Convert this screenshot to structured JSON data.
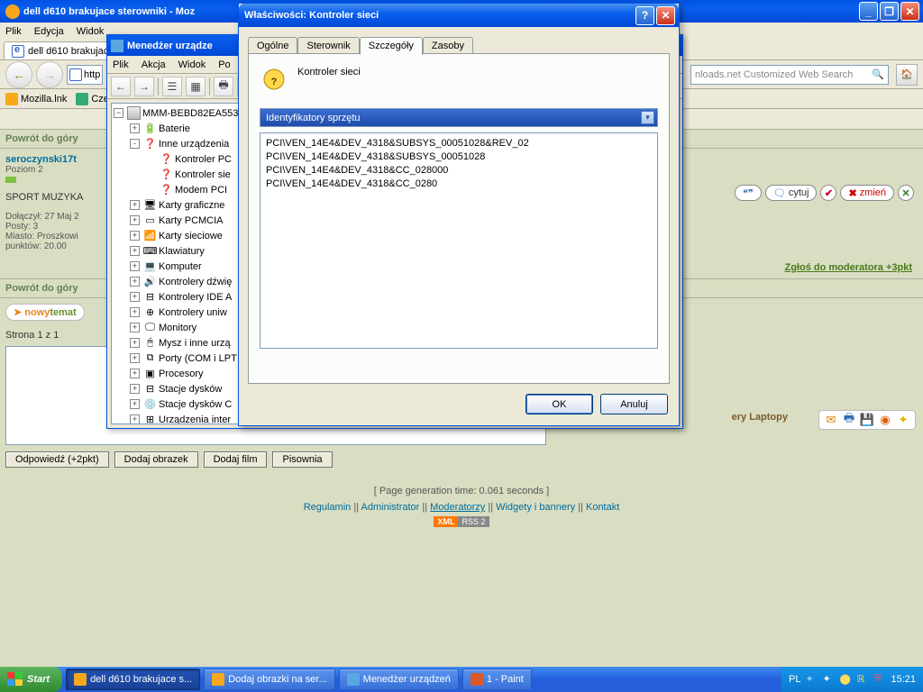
{
  "firefox": {
    "title": "dell d610 brakujace sterowniki - Moz",
    "menu": [
      "Plik",
      "Edycja",
      "Widok"
    ],
    "tab_label": "dell d610 brakujace",
    "url": "http",
    "search_placeholder": "nloads.net Customized Web Search",
    "bookmarks": [
      "Mozilla.lnk",
      "Cze"
    ]
  },
  "forum": {
    "back_top1": "Powrót do góry",
    "back_top2": "Powrót do góry",
    "user": {
      "name": "seroczynski17t",
      "level": "Poziom 2",
      "sig": "SPORT MUZYKA",
      "joined": "Dołączył: 27 Maj 2",
      "posts": "Posty: 3",
      "city": "Miasto: Proszkowi",
      "points": "punktów: 20.00"
    },
    "actions": {
      "quote": "cytuj",
      "edit": "zmień"
    },
    "report": "Zgłoś do moderatora +3pkt",
    "newtopic_a": "nowy",
    "newtopic_b": "temat",
    "page": "Strona 1 z 1",
    "crumb": "ery Laptopy",
    "reply_btns": [
      "Odpowiedź (+2pkt)",
      "Dodaj obrazek",
      "Dodaj film",
      "Pisownia"
    ],
    "gen": "[ Page generation time: 0.061 seconds ]",
    "links": [
      "Regulamin",
      "Administrator",
      "Moderatorzy",
      "Widgety i bannery",
      "Kontakt"
    ],
    "xml": "XML",
    "rss": "RSS 2"
  },
  "devmgr": {
    "title": "Menedżer urządze",
    "menu": [
      "Plik",
      "Akcja",
      "Widok",
      "Po"
    ],
    "root": "MMM-BEBD82EA553",
    "items": [
      {
        "label": "Baterie",
        "exp": "+",
        "icon": "🔋",
        "i": 1
      },
      {
        "label": "Inne urządzenia",
        "exp": "-",
        "icon": "❓",
        "i": 1
      },
      {
        "label": "Kontroler PC",
        "icon": "❓",
        "i": 2,
        "warn": true
      },
      {
        "label": "Kontroler sie",
        "icon": "❓",
        "i": 2,
        "warn": true
      },
      {
        "label": "Modem PCI",
        "icon": "❓",
        "i": 2,
        "warn": true
      },
      {
        "label": "Karty graficzne",
        "exp": "+",
        "icon": "🖥",
        "i": 1
      },
      {
        "label": "Karty PCMCIA",
        "exp": "+",
        "icon": "▭",
        "i": 1
      },
      {
        "label": "Karty sieciowe",
        "exp": "+",
        "icon": "📶",
        "i": 1
      },
      {
        "label": "Klawiatury",
        "exp": "+",
        "icon": "⌨",
        "i": 1
      },
      {
        "label": "Komputer",
        "exp": "+",
        "icon": "💻",
        "i": 1
      },
      {
        "label": "Kontrolery dźwię",
        "exp": "+",
        "icon": "🔊",
        "i": 1
      },
      {
        "label": "Kontrolery IDE A",
        "exp": "+",
        "icon": "⊟",
        "i": 1
      },
      {
        "label": "Kontrolery uniw",
        "exp": "+",
        "icon": "⊕",
        "i": 1
      },
      {
        "label": "Monitory",
        "exp": "+",
        "icon": "🖵",
        "i": 1
      },
      {
        "label": "Mysz i inne urzą",
        "exp": "+",
        "icon": "🖱",
        "i": 1
      },
      {
        "label": "Porty (COM i LPT",
        "exp": "+",
        "icon": "⧉",
        "i": 1
      },
      {
        "label": "Procesory",
        "exp": "+",
        "icon": "▣",
        "i": 1
      },
      {
        "label": "Stacje dysków",
        "exp": "+",
        "icon": "⊟",
        "i": 1
      },
      {
        "label": "Stacje dysków C",
        "exp": "+",
        "icon": "💿",
        "i": 1
      },
      {
        "label": "Urządzenia inter",
        "exp": "+",
        "icon": "⊞",
        "i": 1
      }
    ]
  },
  "props": {
    "title": "Właściwości: Kontroler sieci",
    "tabs": [
      "Ogólne",
      "Sterownik",
      "Szczegóły",
      "Zasoby"
    ],
    "device_name": "Kontroler sieci",
    "dropdown": "Identyfikatory sprzętu",
    "ids": [
      "PCI\\VEN_14E4&DEV_4318&SUBSYS_00051028&REV_02",
      "PCI\\VEN_14E4&DEV_4318&SUBSYS_00051028",
      "PCI\\VEN_14E4&DEV_4318&CC_028000",
      "PCI\\VEN_14E4&DEV_4318&CC_0280"
    ],
    "ok": "OK",
    "cancel": "Anuluj"
  },
  "taskbar": {
    "start": "Start",
    "tasks": [
      "dell d610 brakujace s...",
      "Dodaj obrazki na ser...",
      "Menedżer urządzeń",
      "1 - Paint"
    ],
    "lang": "PL",
    "time": "15:21"
  }
}
